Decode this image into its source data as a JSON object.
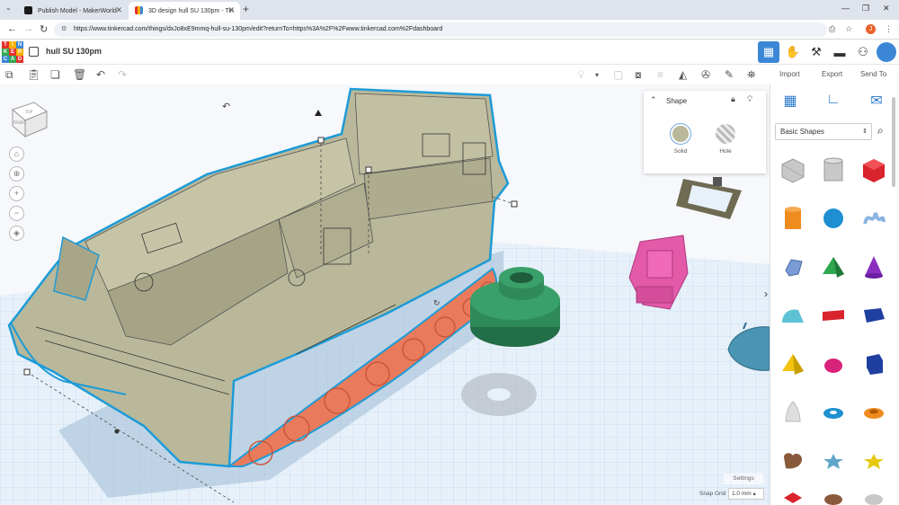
{
  "browser": {
    "tabs": [
      {
        "title": "Publish Model - MakerWorld",
        "active": false
      },
      {
        "title": "3D design hull SU 130pm - Tin",
        "active": true
      }
    ],
    "url": "https://www.tinkercad.com/things/dxJo8xE9mmq-hull-su-130pm/edit?returnTo=https%3A%2F%2Fwww.tinkercad.com%2Fdashboard",
    "profile_initial": "J"
  },
  "app": {
    "logo_letters": [
      "TIN",
      "KER",
      "CAD"
    ],
    "design_title": "hull SU 130pm",
    "import_label": "Import",
    "export_label": "Export",
    "sendto_label": "Send To"
  },
  "viewcube": {
    "top": "TOP",
    "front": "FRONT"
  },
  "inspector": {
    "title": "Shape",
    "solid_label": "Solid",
    "hole_label": "Hole",
    "solid_color": "#b9b89a"
  },
  "library": {
    "category": "Basic Shapes",
    "shapes": [
      "box-hole",
      "cylinder-hole",
      "box",
      "cylinder",
      "sphere",
      "scribble",
      "polygon",
      "pyramid",
      "cone",
      "roof",
      "text",
      "box-blue",
      "paraboloid",
      "half-sphere",
      "polygon-blue",
      "cone-white",
      "torus",
      "tube",
      "heart",
      "star",
      "star-yellow"
    ]
  },
  "footer": {
    "settings_label": "Settings",
    "snap_grid_label": "Snap Grid",
    "snap_grid_value": "1.0 mm"
  },
  "colors": {
    "accent": "#3b87d6",
    "hull": "#b9b89a",
    "tracks": "#e97b5c",
    "green_part": "#2f8a5a",
    "pink_part": "#e35aa8"
  }
}
